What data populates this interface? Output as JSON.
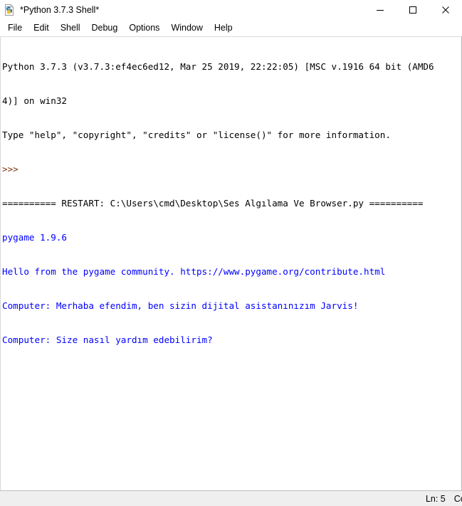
{
  "window": {
    "title": "*Python 3.7.3 Shell*",
    "icon": "python-idle-icon",
    "controls": {
      "minimize": "minimize-icon",
      "maximize": "maximize-icon",
      "close": "close-icon"
    }
  },
  "menu": {
    "items": [
      {
        "label": "File"
      },
      {
        "label": "Edit"
      },
      {
        "label": "Shell"
      },
      {
        "label": "Debug"
      },
      {
        "label": "Options"
      },
      {
        "label": "Window"
      },
      {
        "label": "Help"
      }
    ]
  },
  "shell": {
    "lines": [
      {
        "text": "Python 3.7.3 (v3.7.3:ef4ec6ed12, Mar 25 2019, 22:22:05) [MSC v.1916 64 bit (AMD6",
        "kind": "stdin"
      },
      {
        "text": "4)] on win32",
        "kind": "stdin"
      },
      {
        "text": "Type \"help\", \"copyright\", \"credits\" or \"license()\" for more information.",
        "kind": "stdin"
      },
      {
        "text": ">>>",
        "kind": "prompt"
      },
      {
        "text": "========== RESTART: C:\\Users\\cmd\\Desktop\\Ses Algılama Ve Browser.py ==========",
        "kind": "stdin"
      },
      {
        "text": "pygame 1.9.6",
        "kind": "stdout"
      },
      {
        "text": "Hello from the pygame community. https://www.pygame.org/contribute.html",
        "kind": "stdout"
      },
      {
        "text": "Computer: Merhaba efendim, ben sizin dijital asistanınızım Jarvis!",
        "kind": "stdout"
      },
      {
        "text": "Computer: Size nasıl yardım edebilirim?",
        "kind": "stdout"
      }
    ]
  },
  "status": {
    "line_label": "Ln: 5",
    "col_label": "Col:"
  },
  "colors": {
    "stdout": "#0000ff",
    "prompt": "#7f2f0f",
    "stdin": "#000000",
    "window_bg": "#ffffff",
    "status_bg": "#efefef"
  }
}
